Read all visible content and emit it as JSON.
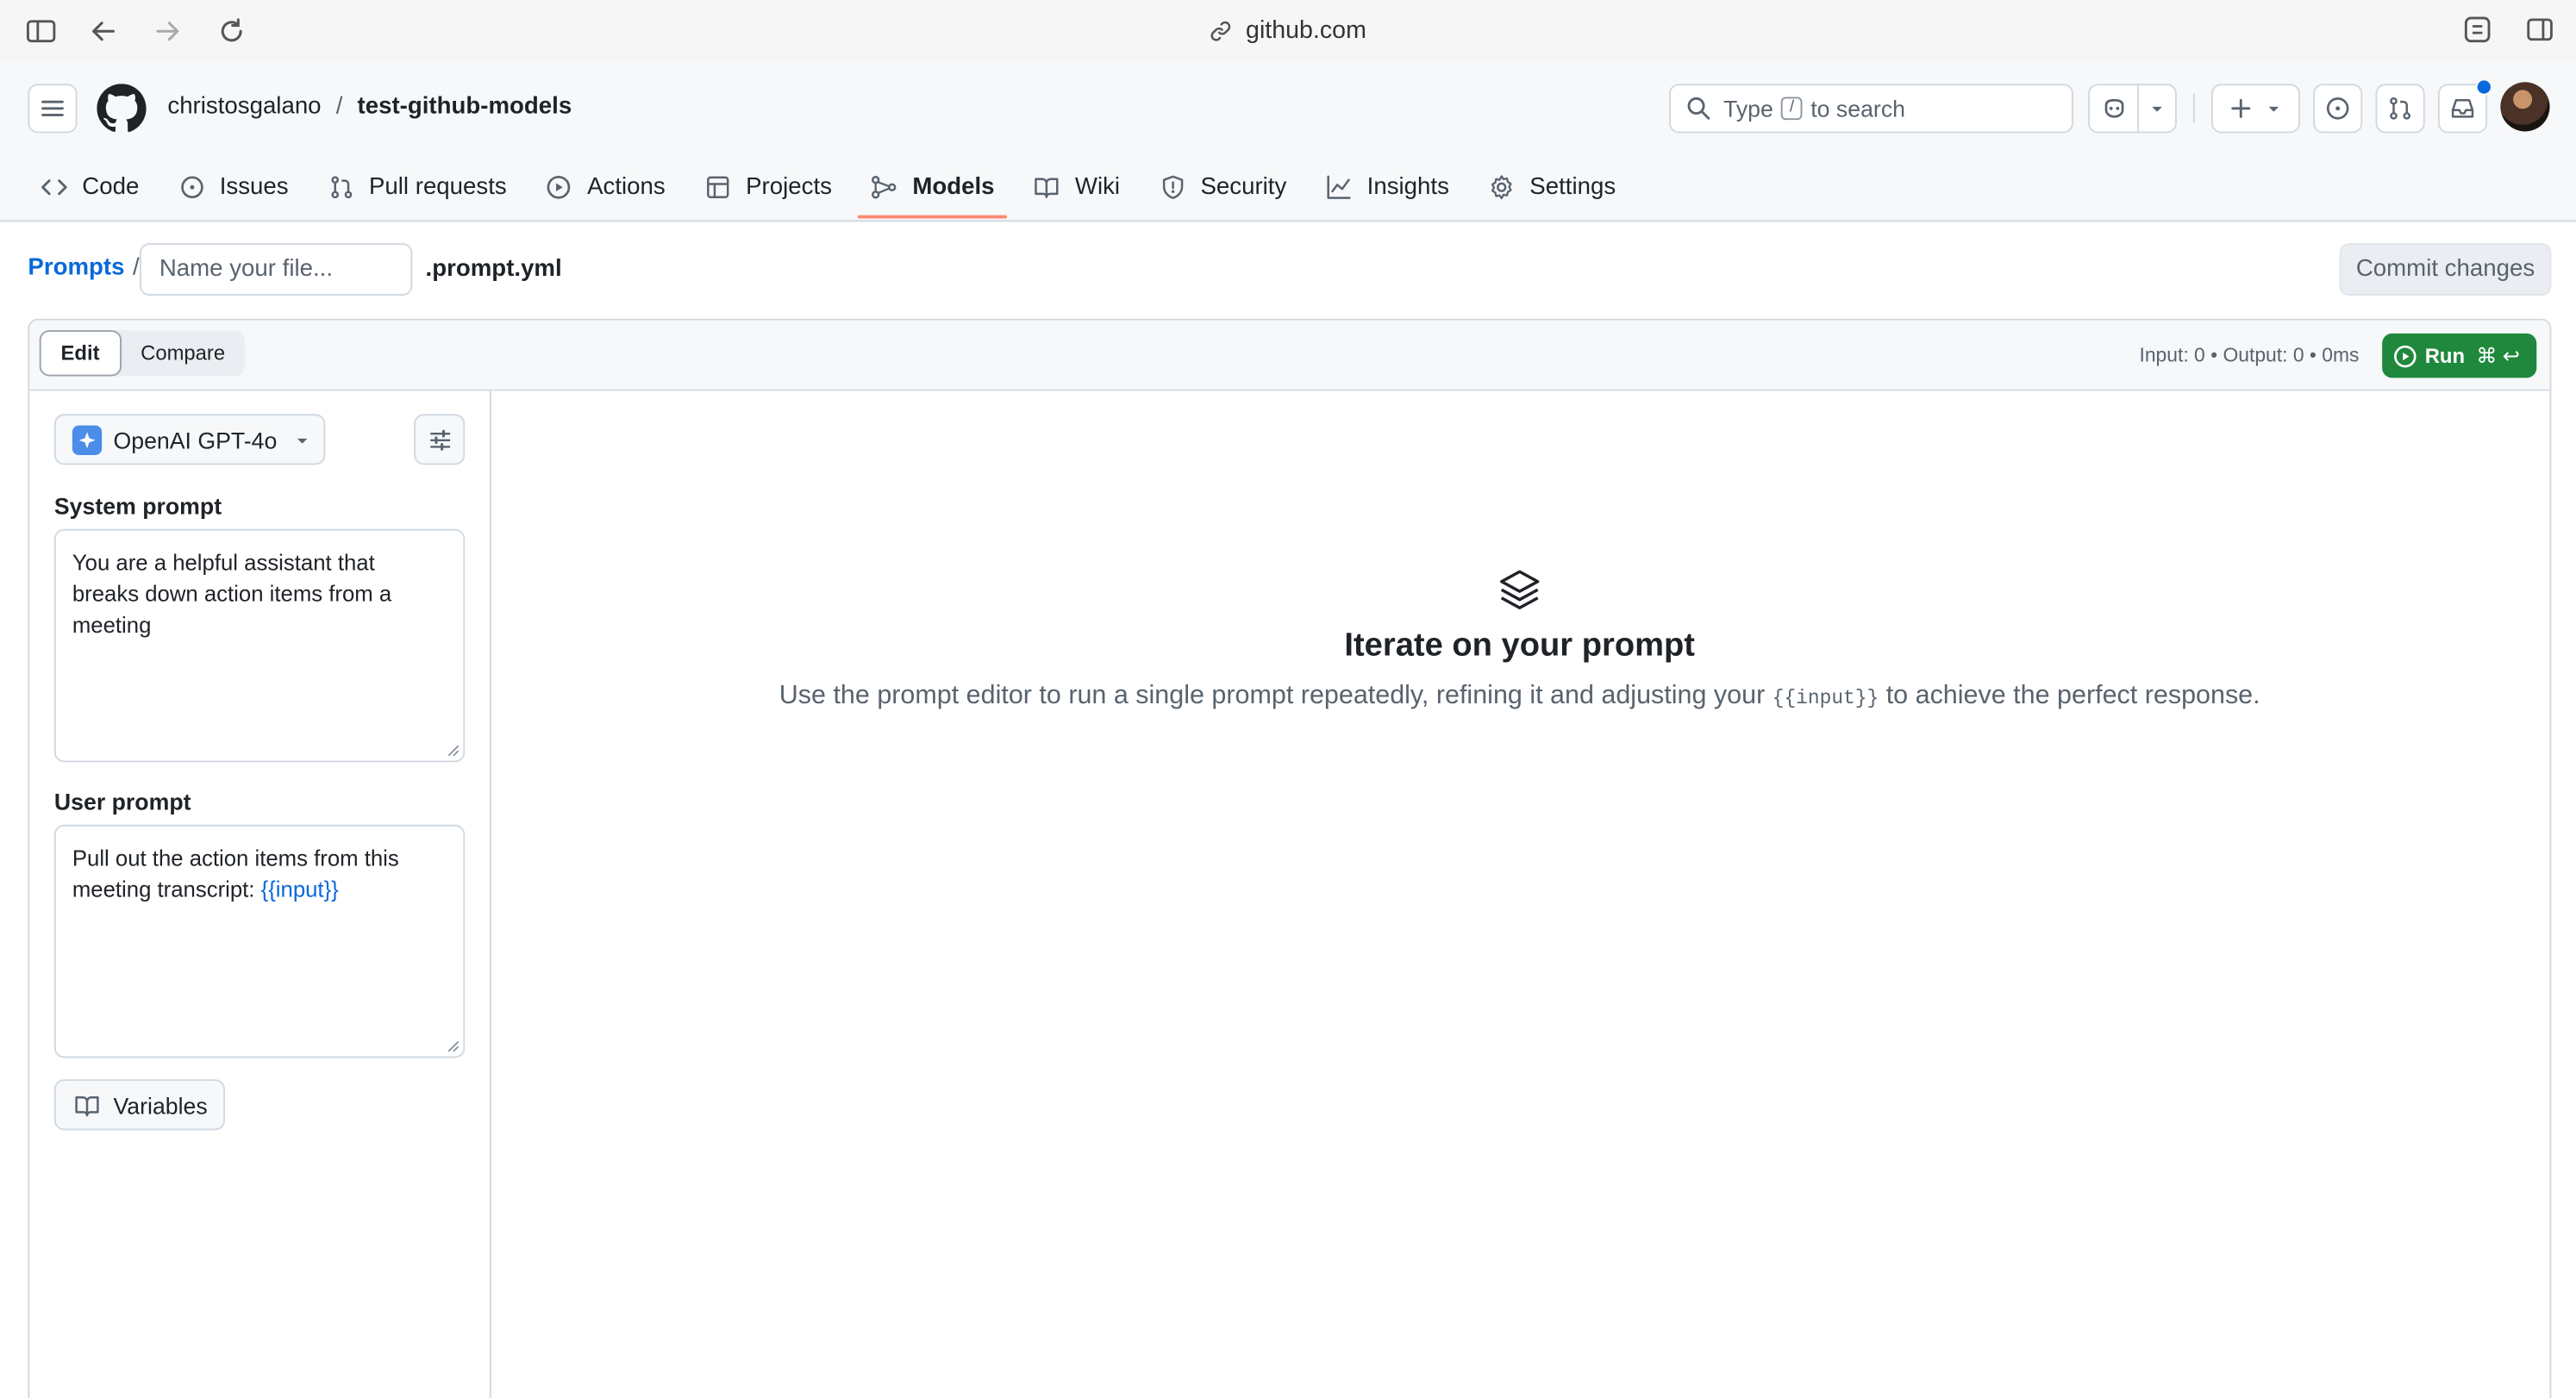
{
  "browser": {
    "url": "github.com"
  },
  "repo": {
    "owner": "christosgalano",
    "name": "test-github-models"
  },
  "search": {
    "prefix": "Type",
    "key": "/",
    "suffix": "to search"
  },
  "tabs": [
    "Code",
    "Issues",
    "Pull requests",
    "Actions",
    "Projects",
    "Models",
    "Wiki",
    "Security",
    "Insights",
    "Settings"
  ],
  "active_tab": "Models",
  "breadcrumb": {
    "root": "Prompts",
    "separator": "/",
    "filename_placeholder": "Name your file...",
    "filename_value": "",
    "extension": ".prompt.yml"
  },
  "commit_label": "Commit changes",
  "mode": {
    "edit": "Edit",
    "compare": "Compare",
    "selected": "Edit"
  },
  "stats": {
    "text": "Input: 0 • Output: 0 • 0ms"
  },
  "run": {
    "label": "Run",
    "shortcut": "⌘ ↩"
  },
  "model": {
    "name": "OpenAI GPT-4o"
  },
  "system_prompt": {
    "label": "System prompt",
    "value": "You are a helpful assistant that breaks down action items from a meeting"
  },
  "user_prompt": {
    "label": "User prompt",
    "text": "Pull out the action items from this meeting transcript: ",
    "variable": "{{input}}"
  },
  "variables_label": "Variables",
  "empty_state": {
    "title": "Iterate on your prompt",
    "text_before": "Use the prompt editor to run a single prompt repeatedly, refining it and adjusting your",
    "code": "{{input}}",
    "text_after": "to achieve the perfect response."
  },
  "colors": {
    "run_button": "#1f883d",
    "link": "#0969da",
    "active_tab_underline": "#fd8c73"
  }
}
